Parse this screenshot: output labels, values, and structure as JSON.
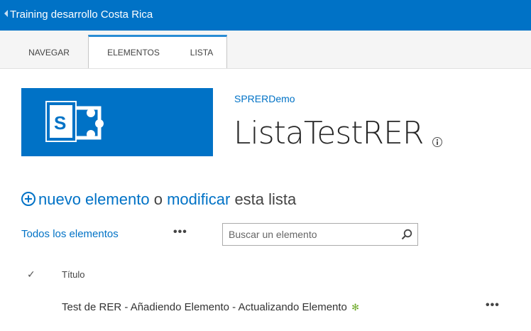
{
  "suite_bar": {
    "site_name": "Training desarrollo Costa Rica",
    "color": "#0072c6"
  },
  "ribbon": {
    "tabs": [
      {
        "label": "NAVEGAR"
      },
      {
        "label": "ELEMENTOS"
      },
      {
        "label": "LISTA"
      }
    ]
  },
  "header": {
    "logo_icon": "sharepoint-logo-icon",
    "site_link": "SPRERDemo",
    "title": "ListaTestRER"
  },
  "actions": {
    "new_item": "nuevo elemento",
    "or": "o",
    "modify": "modificar",
    "this_list": "esta lista"
  },
  "view": {
    "all_items": "Todos los elementos",
    "more": "•••",
    "search_placeholder": "Buscar un elemento"
  },
  "list": {
    "check_header": "✓",
    "columns": [
      "Título"
    ],
    "rows": [
      {
        "title": "Test de RER - Añadiendo Elemento - Actualizando Elemento",
        "new_badge": "✻",
        "more": "•••"
      }
    ]
  }
}
